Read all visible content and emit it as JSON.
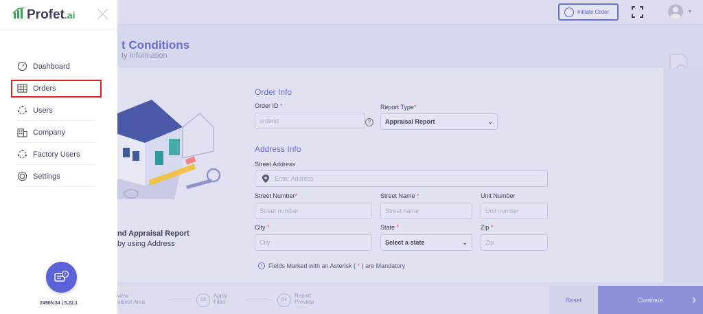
{
  "topbar": {
    "initiate_label": "Initiate Order"
  },
  "header": {
    "title": "t Conditions",
    "subtitle": "ty Information"
  },
  "promo": {
    "title": "nd Appraisal Report",
    "subtitle": "by using Address"
  },
  "order_info": {
    "title": "Order Info",
    "order_id_label": "Order ID",
    "order_id_placeholder": "orderid",
    "report_type_label": "Report Type",
    "report_type_value": "Appraisal Report"
  },
  "address_info": {
    "title": "Address Info",
    "street_address_label": "Street Address",
    "street_address_placeholder": "Enter Address",
    "street_number_label": "Street Number",
    "street_number_placeholder": "Street number",
    "street_name_label": "Street Name",
    "street_name_placeholder": "Street name",
    "unit_number_label": "Unit Number",
    "unit_number_placeholder": "Unit number",
    "city_label": "City",
    "city_placeholder": "City",
    "state_label": "State",
    "state_value": "Select a state",
    "zip_label": "Zip",
    "zip_placeholder": "Zip"
  },
  "note": {
    "prefix": "Fields Marked with an Asterisk (",
    "asterisk": "*",
    "suffix": ") are Mandatory"
  },
  "required_mark": "*",
  "steps": [
    {
      "num": "",
      "label_1": "view",
      "label_2": "ubject Area"
    },
    {
      "num": "03",
      "label_1": "Apply",
      "label_2": "Filter"
    },
    {
      "num": "04",
      "label_1": "Report",
      "label_2": "Preview"
    }
  ],
  "buttons": {
    "reset": "Reset",
    "continue": "Continue"
  },
  "sidebar": {
    "logo_text": "Profet",
    "logo_suffix": ".ai",
    "items": [
      {
        "label": "Dashboard",
        "icon": "gauge-icon"
      },
      {
        "label": "Orders",
        "icon": "grid-table-icon"
      },
      {
        "label": "Users",
        "icon": "users-icon"
      },
      {
        "label": "Company",
        "icon": "building-icon"
      },
      {
        "label": "Factory Users",
        "icon": "factory-users-icon"
      },
      {
        "label": "Settings",
        "icon": "settings-icon"
      }
    ],
    "version": "2490fc34 | 5.22.1"
  },
  "colors": {
    "accent": "#6a6ec8",
    "continue": "#8c91d8",
    "highlight": "#e02020",
    "brand_green": "#3aa35a"
  }
}
